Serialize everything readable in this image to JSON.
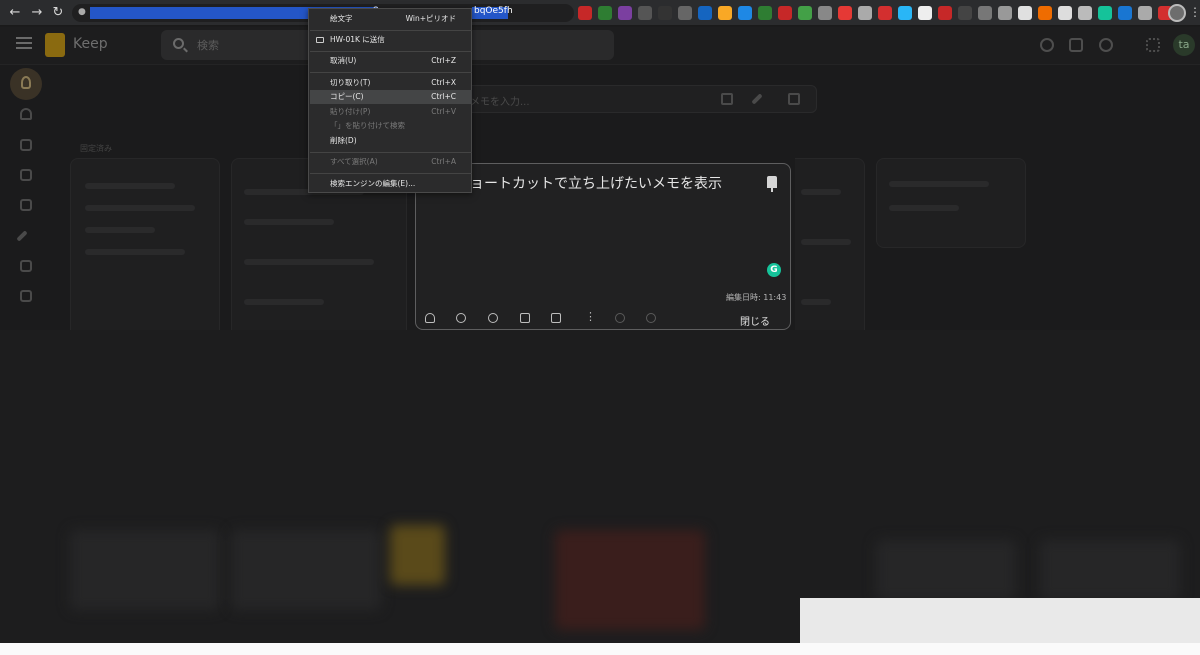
{
  "browser": {
    "url_visible_tail": "bqOe5fh",
    "url_mid_fragment": ".8"
  },
  "keep": {
    "app_name": "Keep",
    "search_placeholder": "検索",
    "take_note_placeholder": "メモを入力...",
    "account_initials": "ta",
    "pinned_label": "固定済み"
  },
  "note": {
    "title": "ショートカットで立ち上げたいメモを表示",
    "edited": "編集日時: 11:43",
    "close_label": "閉じる",
    "grammarly_badge": "G"
  },
  "context_menu": {
    "items": [
      {
        "label": "絵文字",
        "shortcut": "Win+ピリオド",
        "state": "normal"
      },
      {
        "label": "HW-01K に送信",
        "shortcut": "",
        "state": "normal"
      },
      {
        "label": "取消(U)",
        "shortcut": "Ctrl+Z",
        "state": "normal"
      },
      {
        "label": "切り取り(T)",
        "shortcut": "Ctrl+X",
        "state": "normal"
      },
      {
        "label": "コピー(C)",
        "shortcut": "Ctrl+C",
        "state": "highlighted"
      },
      {
        "label": "貼り付け(P)",
        "shortcut": "Ctrl+V",
        "state": "disabled"
      },
      {
        "label": "「」を貼り付けて検索",
        "shortcut": "",
        "state": "disabled"
      },
      {
        "label": "削除(D)",
        "shortcut": "",
        "state": "normal"
      },
      {
        "label": "すべて選択(A)",
        "shortcut": "Ctrl+A",
        "state": "disabled"
      },
      {
        "label": "検索エンジンの編集(E)...",
        "shortcut": "",
        "state": "normal"
      }
    ]
  },
  "colors": {
    "background": "#1b1b1c",
    "selection": "#2456c7",
    "grammarly": "#15c39a",
    "keep_yellow": "#8a6a10"
  }
}
